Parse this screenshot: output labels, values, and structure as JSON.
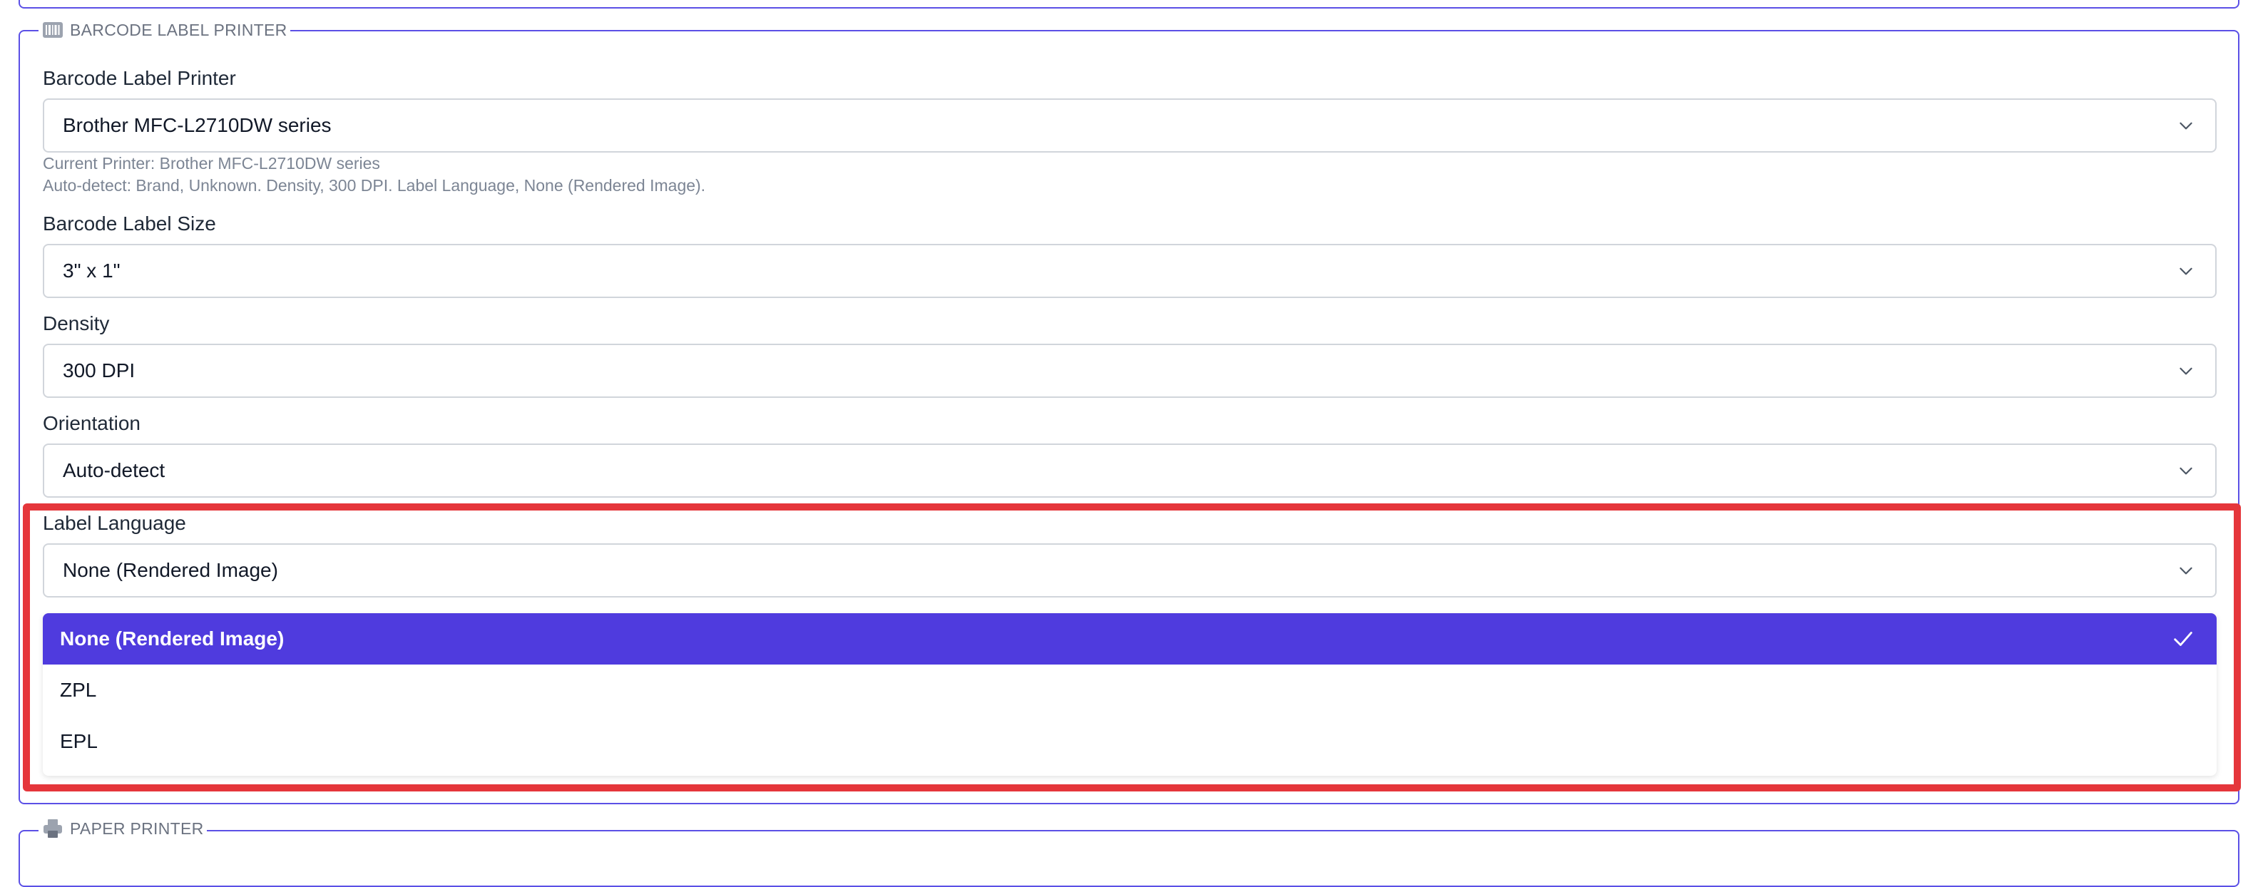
{
  "barcode_section": {
    "legend": "BARCODE LABEL PRINTER",
    "legend_icon": "barcode-icon",
    "printer": {
      "label": "Barcode Label Printer",
      "value": "Brother MFC-L2710DW series",
      "current_printer": "Current Printer: Brother MFC-L2710DW series",
      "auto_detect": "Auto-detect: Brand, Unknown. Density, 300 DPI. Label Language, None (Rendered Image)."
    },
    "label_size": {
      "label": "Barcode Label Size",
      "value": "3\" x 1\""
    },
    "density": {
      "label": "Density",
      "value": "300 DPI"
    },
    "orientation": {
      "label": "Orientation",
      "value": "Auto-detect"
    },
    "label_language": {
      "label": "Label Language",
      "value": "None (Rendered Image)",
      "options": [
        {
          "label": "None (Rendered Image)",
          "selected": true
        },
        {
          "label": "ZPL",
          "selected": false
        },
        {
          "label": "EPL",
          "selected": false
        }
      ]
    }
  },
  "paper_section": {
    "legend": "PAPER PRINTER",
    "legend_icon": "printer-icon"
  },
  "colors": {
    "frame": "#5b50e6",
    "selected_option": "#4f3bde",
    "highlight": "#e5363b"
  }
}
